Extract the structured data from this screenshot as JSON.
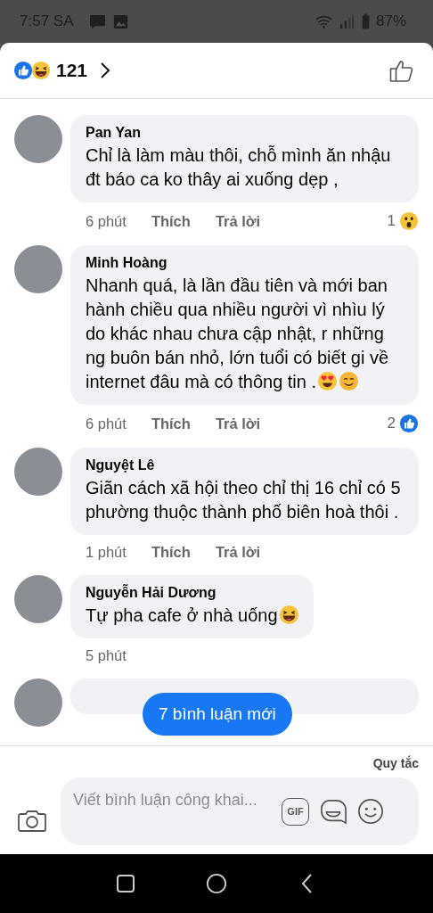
{
  "status_bar": {
    "time": "7:57 SA",
    "battery": "87%"
  },
  "header": {
    "reaction_count": "121"
  },
  "comments": [
    {
      "author": "Pan Yan",
      "text": "Chỉ là làm màu thôi, chỗ mình ăn nhậu đt báo ca ko thây ai xuống dẹp ,",
      "time": "6 phút",
      "like": "Thích",
      "reply": "Trả lời",
      "reaction": {
        "kind": "wow",
        "count": "1"
      }
    },
    {
      "author": "Minh Hoàng",
      "text": "Nhanh quá, là lần đầu tiên và mới ban hành chiều qua nhiều người vì nhìu lý do khác nhau chưa cập nhật, r những ng buôn bán nhỏ, lớn tuổi  có biết gi về internet đâu mà có thông tin .",
      "emoji": [
        {
          "kind": "heart-eyes"
        },
        {
          "kind": "smile"
        }
      ],
      "time": "6 phút",
      "like": "Thích",
      "reply": "Trả lời",
      "reaction": {
        "kind": "like",
        "count": "2"
      }
    },
    {
      "author": "Nguyệt Lê",
      "text": "Giãn cách xã hội theo chỉ thị 16 chỉ có 5 phường thuộc thành phố biên hoà thôi .",
      "time": "1 phút",
      "like": "Thích",
      "reply": "Trả lời"
    },
    {
      "author": "Nguyễn Hải Dương",
      "text": "Tự pha cafe ở nhà uống",
      "emoji": [
        {
          "kind": "laugh"
        }
      ],
      "time": "5 phút"
    }
  ],
  "new_comments_button": "7 bình luận mới",
  "footer": {
    "rules_link": "Quy tắc",
    "comment_field": {
      "placeholder": "Viết bình luận công khai..."
    },
    "gif_label": "GIF"
  }
}
